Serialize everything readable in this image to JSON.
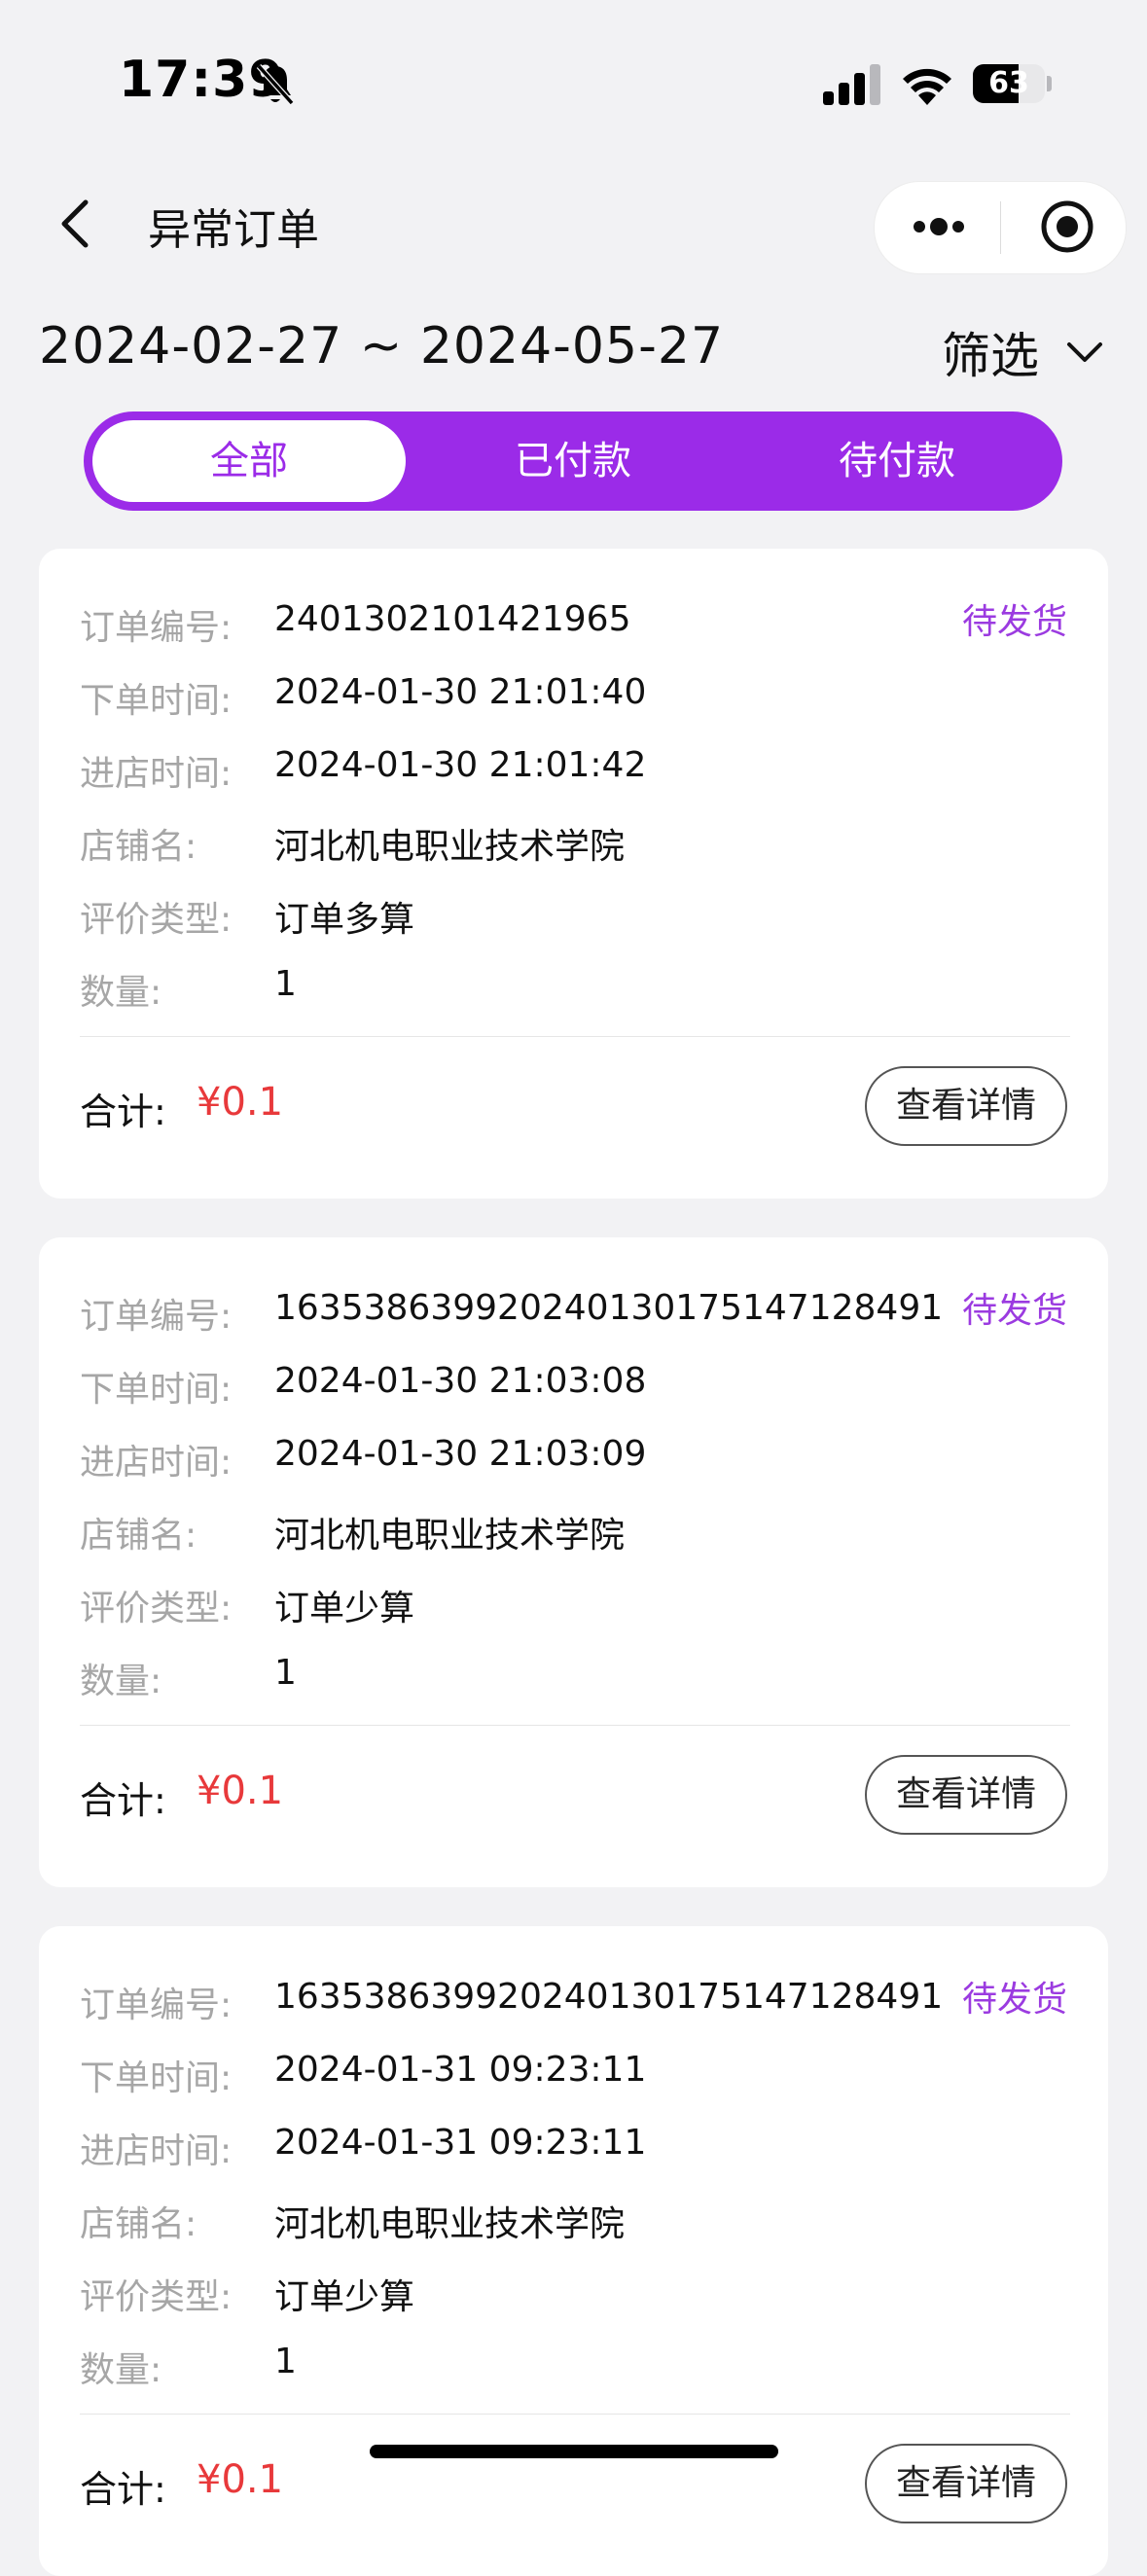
{
  "status_bar": {
    "time": "17:39",
    "battery_percent": "63",
    "battery_level": 0.63
  },
  "nav": {
    "title": "异常订单",
    "back_icon": "chevron-left-icon",
    "more_icon": "more-dots-icon",
    "close_icon": "target-close-icon"
  },
  "filter": {
    "date_range": "2024-02-27 ~ 2024-05-27",
    "filter_label": "筛选"
  },
  "tabs": [
    {
      "label": "全部",
      "active": true
    },
    {
      "label": "已付款",
      "active": false
    },
    {
      "label": "待付款",
      "active": false
    }
  ],
  "labels": {
    "order_no": "订单编号:",
    "order_time": "下单时间:",
    "enter_time": "进店时间:",
    "shop": "店铺名:",
    "review_type": "评价类型:",
    "quantity": "数量:",
    "total": "合计:",
    "detail_button": "查看详情"
  },
  "orders": [
    {
      "order_no": "2401302101421965",
      "status": "待发货",
      "order_time": "2024-01-30 21:01:40",
      "enter_time": "2024-01-30 21:01:42",
      "shop": "河北机电职业技术学院",
      "review_type": "订单多算",
      "quantity": "1",
      "total": "¥0.1"
    },
    {
      "order_no": "16353863992024013017514712849​1",
      "status": "待发货",
      "order_time": "2024-01-30 21:03:08",
      "enter_time": "2024-01-30 21:03:09",
      "shop": "河北机电职业技术学院",
      "review_type": "订单少算",
      "quantity": "1",
      "total": "¥0.1"
    },
    {
      "order_no": "16353863992024013017514712849​1",
      "status": "待发货",
      "order_time": "2024-01-31 09:23:11",
      "enter_time": "2024-01-31 09:23:11",
      "shop": "河北机电职业技术学院",
      "review_type": "订单少算",
      "quantity": "1",
      "total": "¥0.1"
    }
  ]
}
